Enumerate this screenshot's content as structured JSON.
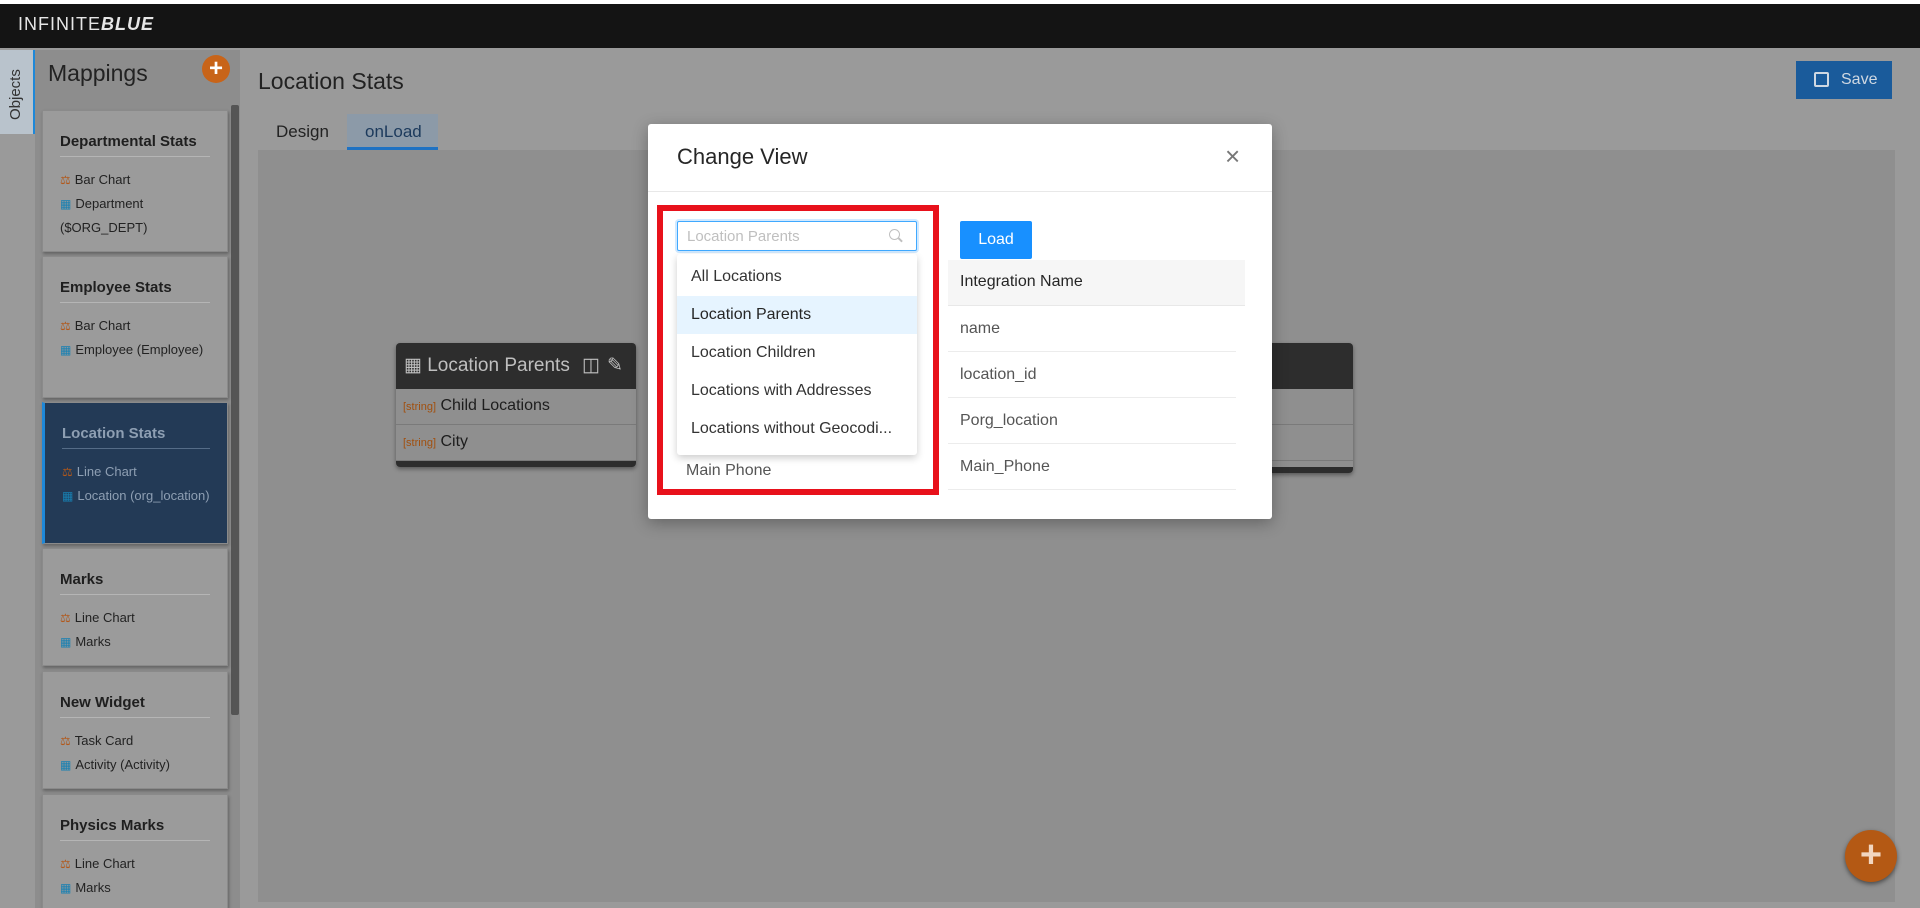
{
  "app": {
    "logo_left": "INFINITE",
    "logo_right": "BLUE"
  },
  "objects_tab": {
    "label": "Objects"
  },
  "mappings": {
    "title": "Mappings",
    "add_label": "+",
    "items": [
      {
        "title": "Departmental Stats",
        "chart": "Bar Chart",
        "object": "Department ($ORG_DEPT)",
        "active": false
      },
      {
        "title": "Employee Stats",
        "chart": "Bar Chart",
        "object": "Employee (Employee)",
        "active": false
      },
      {
        "title": "Location Stats",
        "chart": "Line Chart",
        "object": "Location (org_location)",
        "active": true
      },
      {
        "title": "Marks",
        "chart": "Line Chart",
        "object": "Marks",
        "active": false
      },
      {
        "title": "New Widget",
        "chart": "Task Card",
        "object": "Activity (Activity)",
        "active": false
      },
      {
        "title": "Physics Marks",
        "chart": "Line Chart",
        "object": "Marks",
        "active": false
      }
    ]
  },
  "main": {
    "title": "Location Stats",
    "save_label": "Save",
    "tabs": [
      {
        "label": "Design"
      },
      {
        "label": "onLoad"
      }
    ],
    "entity": {
      "title": "Location Parents",
      "rows": [
        {
          "type": "[string]",
          "name": "Child Locations"
        },
        {
          "type": "[string]",
          "name": "City"
        }
      ]
    },
    "fab_label": "+"
  },
  "modal": {
    "title": "Change View",
    "close_label": "×",
    "select": {
      "placeholder": "Location Parents"
    },
    "dropdown": {
      "options": [
        "All Locations",
        "Location Parents",
        "Location Children",
        "Locations with Addresses",
        "Locations without Geocodi..."
      ],
      "selected_index": 1
    },
    "load_label": "Load",
    "table": {
      "column_header": "Integration Name",
      "rows": [
        "name",
        "location_id",
        "Porg_location",
        "Main_Phone"
      ],
      "left_visible_cell": "Main Phone"
    }
  },
  "colors": {
    "highlight_border": "#e8111b",
    "primary_blue": "#1890ff",
    "fab_orange": "#b45914"
  }
}
